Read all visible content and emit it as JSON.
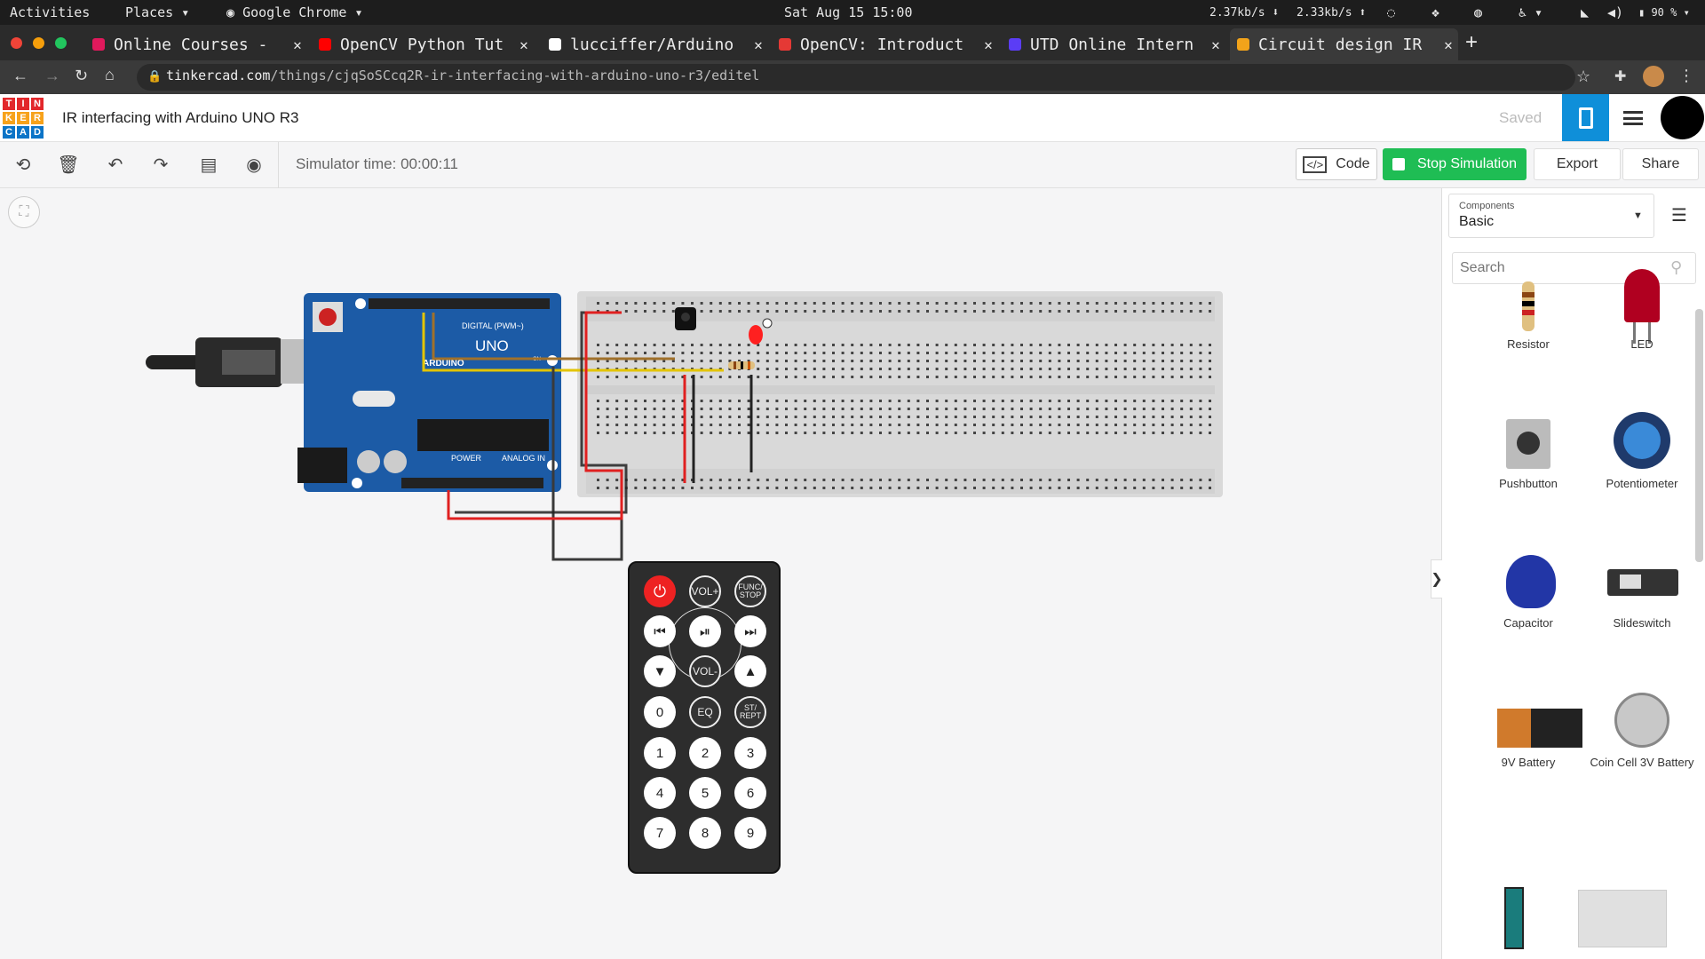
{
  "os_bar": {
    "activities": "Activities",
    "places": "Places",
    "app": "Google Chrome",
    "datetime": "Sat Aug 15 15:00",
    "net_down": "2.37kb/s",
    "net_up": "2.33kb/s",
    "battery": "90 %"
  },
  "browser": {
    "tabs": [
      {
        "title": "Online Courses -",
        "color": "#e0195c"
      },
      {
        "title": "OpenCV Python Tut",
        "color": "#ff0000"
      },
      {
        "title": "lucciffer/Arduino",
        "color": "#ffffff"
      },
      {
        "title": "OpenCV: Introduct",
        "color": "#e53935"
      },
      {
        "title": "UTD Online Intern",
        "color": "#5b3df5"
      },
      {
        "title": "Circuit design IR",
        "color": "#f2a31a"
      }
    ],
    "new_tab": "+",
    "url_host": "tinkercad.com",
    "url_path": "/things/cjqSoSCcq2R-ir-interfacing-with-arduino-uno-r3/editel"
  },
  "app": {
    "logo_letters": [
      "T",
      "I",
      "N",
      "K",
      "E",
      "R",
      "C",
      "A",
      "D"
    ],
    "logo_colors": [
      "#e2272b",
      "#e2272b",
      "#e2272b",
      "#f7a21b",
      "#f7a21b",
      "#f7a21b",
      "#0b74c7",
      "#0b74c7",
      "#0b74c7"
    ],
    "title": "IR interfacing with Arduino UNO R3",
    "saved": "Saved",
    "simulator_time": "Simulator time: 00:00:11",
    "code_label": "Code",
    "stop_label": "Stop Simulation",
    "export_label": "Export",
    "share_label": "Share",
    "accent": "#1fbd54",
    "blue": "#0f8fd9"
  },
  "panel": {
    "components_caption": "Components",
    "components_value": "Basic",
    "search_placeholder": "Search",
    "items": [
      {
        "label": "Resistor"
      },
      {
        "label": "LED"
      },
      {
        "label": "Pushbutton"
      },
      {
        "label": "Potentiometer"
      },
      {
        "label": "Capacitor"
      },
      {
        "label": "Slideswitch"
      },
      {
        "label": "9V Battery"
      },
      {
        "label": "Coin Cell 3V Battery"
      }
    ]
  },
  "board": {
    "digital_label": "DIGITAL (PWM~)",
    "uno_label": "UNO",
    "arduino_label": "ARDUINO",
    "power_label": "POWER",
    "analog_label": "ANALOG IN",
    "on_label": "ON"
  },
  "remote": {
    "row1": [
      "VOL+",
      "FUNC/ STOP"
    ],
    "row3": [
      "VOL-"
    ],
    "row4": [
      "0",
      "EQ",
      "ST/ REPT"
    ],
    "digits": [
      "1",
      "2",
      "3",
      "4",
      "5",
      "6",
      "7",
      "8",
      "9"
    ]
  }
}
